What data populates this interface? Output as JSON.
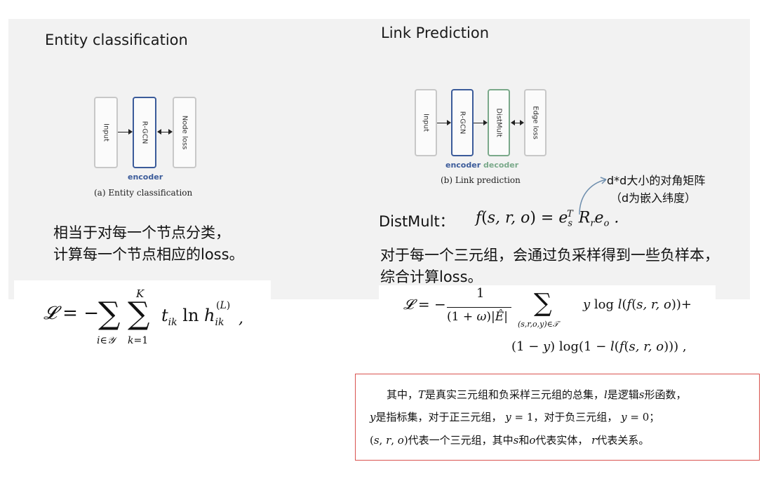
{
  "left": {
    "title": "Entity classification",
    "diagram": {
      "boxes": [
        "Input",
        "R-GCN",
        "Node loss"
      ],
      "encoder_label": "encoder",
      "caption": "(a) Entity classification"
    },
    "description_line1": "相当于对每一个节点分类，",
    "description_line2": "计算每一个节点相应的loss。",
    "formula": "𝓛 = − Σ_{i∈𝒴} Σ_{k=1}^{K} t_{ik} ln h_{ik}^{(L)} ,"
  },
  "right": {
    "title": "Link Prediction",
    "diagram": {
      "boxes": [
        "Input",
        "R-GCN",
        "DistMult",
        "Edge loss"
      ],
      "encoder_label": "encoder",
      "decoder_label": "decoder",
      "caption": "(b) Link prediction"
    },
    "annotation_line1": "d*d大小的对角矩阵",
    "annotation_line2": "（d为嵌入纬度）",
    "distmult_label": "DistMult：",
    "distmult_formula": "f(s, r, o) = e_s^T R_r e_o .",
    "description_line1": "对于每一个三元组，会通过负采样得到一些负样本，",
    "description_line2": "综合计算loss。",
    "loss_formula_line1": "𝓛 = − 1/((1+ω)|Ê|) Σ_{(s,r,o,y)∈𝒯} y log l(f(s, r, o)) +",
    "loss_formula_line2": "(1 − y) log(1 − l(f(s, r, o))) ,"
  },
  "note": {
    "line1": "其中，𝑇是真实三元组和负采样三元组的总集，𝑙是逻辑𝑠形函数，",
    "line2": "𝑦是指标集，对于正三元组， 𝑦 = 1，对于负三元组， 𝑦 = 0；",
    "line3": "(𝑠, 𝑟, 𝑜)代表一个三元组，其中𝑠和𝑜代表实体， 𝑟代表关系。"
  },
  "colors": {
    "panel_bg": "#f2f2f2",
    "encoder": "#3b5b9a",
    "decoder": "#7aa98a",
    "note_border": "#d9534f"
  }
}
